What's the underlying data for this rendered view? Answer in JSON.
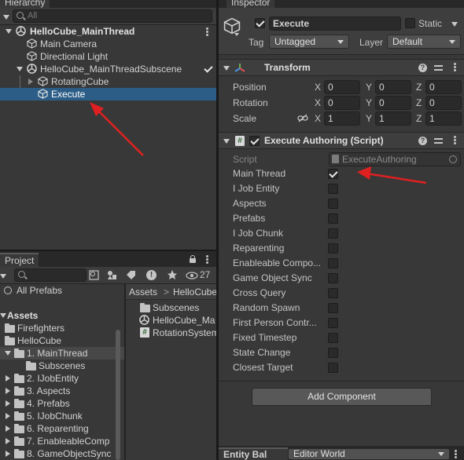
{
  "hierarchy": {
    "tab_label": "Hierarchy",
    "search_placeholder": "All",
    "root": "HelloCube_MainThread",
    "items": [
      {
        "label": "Main Camera"
      },
      {
        "label": "Directional Light"
      },
      {
        "label": "HelloCube_MainThreadSubscene"
      },
      {
        "label": "RotatingCube"
      },
      {
        "label": "Execute"
      }
    ]
  },
  "inspector": {
    "tab_label": "Inspector",
    "object_name": "Execute",
    "static_label": "Static",
    "tag_label": "Tag",
    "tag_value": "Untagged",
    "layer_label": "Layer",
    "layer_value": "Default",
    "transform": {
      "title": "Transform",
      "position_label": "Position",
      "rotation_label": "Rotation",
      "scale_label": "Scale",
      "axis_x": "X",
      "axis_y": "Y",
      "axis_z": "Z",
      "position": {
        "x": "0",
        "y": "0",
        "z": "0"
      },
      "rotation": {
        "x": "0",
        "y": "0",
        "z": "0"
      },
      "scale": {
        "x": "1",
        "y": "1",
        "z": "1"
      }
    },
    "component": {
      "title": "Execute Authoring (Script)",
      "script_label": "Script",
      "script_value": "ExecuteAuthoring",
      "fields": [
        {
          "label": "Main Thread",
          "checked": true
        },
        {
          "label": "I Job Entity",
          "checked": false
        },
        {
          "label": "Aspects",
          "checked": false
        },
        {
          "label": "Prefabs",
          "checked": false
        },
        {
          "label": "I Job Chunk",
          "checked": false
        },
        {
          "label": "Reparenting",
          "checked": false
        },
        {
          "label": "Enableable Compo...",
          "checked": false
        },
        {
          "label": "Game Object Sync",
          "checked": false
        },
        {
          "label": "Cross Query",
          "checked": false
        },
        {
          "label": "Random Spawn",
          "checked": false
        },
        {
          "label": "First Person Contr...",
          "checked": false
        },
        {
          "label": "Fixed Timestep",
          "checked": false
        },
        {
          "label": "State Change",
          "checked": false
        },
        {
          "label": "Closest Target",
          "checked": false
        }
      ]
    },
    "add_component_label": "Add Component"
  },
  "project": {
    "tab_label": "Project",
    "hidden_count": "27",
    "favorites": "All Prefabs",
    "assets_label": "Assets",
    "tree": [
      {
        "label": "Firefighters"
      },
      {
        "label": "HelloCube"
      },
      {
        "label": "1. MainThread"
      },
      {
        "label": "Subscenes"
      },
      {
        "label": "2. IJobEntity"
      },
      {
        "label": "3. Aspects"
      },
      {
        "label": "4. Prefabs"
      },
      {
        "label": "5. IJobChunk"
      },
      {
        "label": "6. Reparenting"
      },
      {
        "label": "7. EnableableComp"
      },
      {
        "label": "8. GameObjectSync"
      }
    ],
    "breadcrumb": {
      "root": "Assets",
      "sep": ">",
      "child": "HelloCube"
    },
    "files": [
      {
        "label": "Subscenes"
      },
      {
        "label": "HelloCube_Ma"
      },
      {
        "label": "RotationSystem"
      }
    ]
  },
  "bottom_bar": {
    "label": "Entity Bal",
    "dropdown": "Editor World"
  },
  "colors": {
    "selection": "#2c5d87",
    "arrow": "#e02020",
    "panel": "#383838"
  }
}
